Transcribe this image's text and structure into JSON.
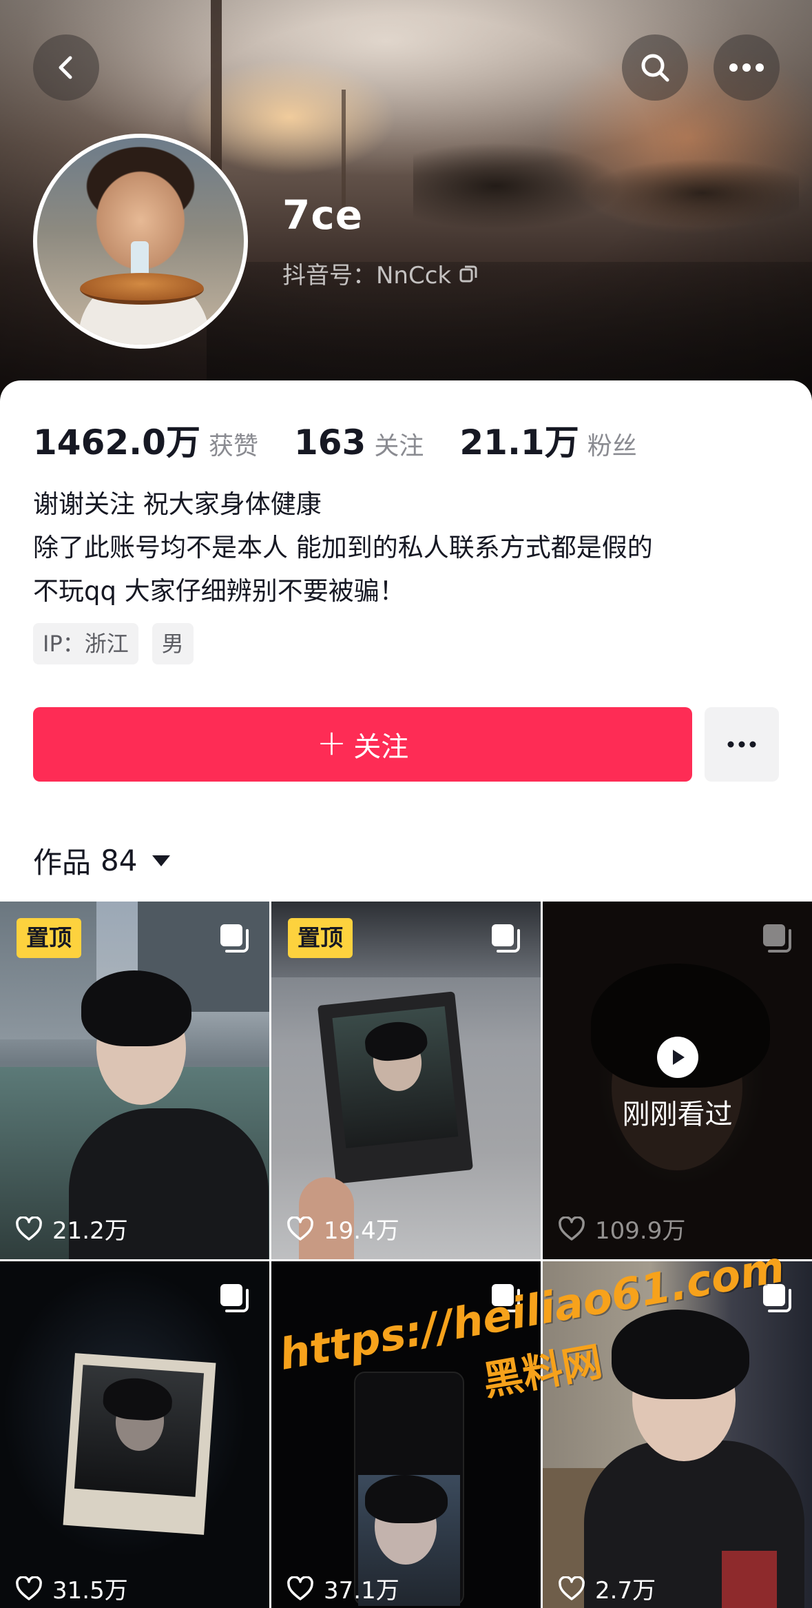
{
  "header": {
    "back_icon": "chevron-left-icon",
    "search_icon": "search-icon",
    "more_icon": "more-horizontal-icon",
    "username": "7ce",
    "douyin_id": "抖音号：NnCck",
    "copy_icon": "copy-icon"
  },
  "stats": [
    {
      "value": "1462.0万",
      "label": "获赞"
    },
    {
      "value": "163",
      "label": "关注"
    },
    {
      "value": "21.1万",
      "label": "粉丝"
    }
  ],
  "bio": [
    "谢谢关注 祝大家身体健康",
    "除了此账号均不是本人 能加到的私人联系方式都是假的",
    "不玩qq 大家仔细辨别不要被骗！"
  ],
  "tags": [
    "IP：浙江",
    "男"
  ],
  "actions": {
    "follow_label": "关注",
    "follow_plus": "+",
    "more_icon": "more-horizontal-icon"
  },
  "works": {
    "label": "作品",
    "count": "84",
    "dropdown_icon": "caret-down-icon"
  },
  "grid": {
    "items": [
      {
        "pinned": "置顶",
        "likes": "21.2万",
        "multi": true
      },
      {
        "pinned": "置顶",
        "likes": "19.4万",
        "multi": true
      },
      {
        "watched": "刚刚看过",
        "likes": "109.9万",
        "multi": true
      },
      {
        "likes": "31.5万",
        "multi": true
      },
      {
        "likes": "37.1万",
        "multi": true
      },
      {
        "likes": "2.7万",
        "multi": true
      }
    ]
  },
  "watermark": {
    "url": "https://heiliao61.com",
    "name": "黑料网"
  },
  "colors": {
    "follow_button": "#fe2c55",
    "pin_badge": "#fdd23e",
    "watermark": "#f7a21b"
  }
}
